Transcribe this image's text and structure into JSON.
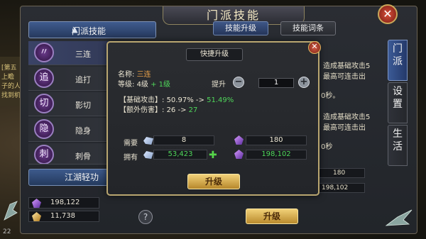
{
  "window": {
    "title": "门派技能"
  },
  "world": {
    "left_notes": [
      "[第五",
      "上瞻",
      "子的人",
      "找到机"
    ],
    "bottom_text": "22"
  },
  "left_panel": {
    "header": "门派技能",
    "skills": [
      {
        "glyph": "",
        "name": "三连"
      },
      {
        "glyph": "追",
        "name": "追打"
      },
      {
        "glyph": "切",
        "name": "影切"
      },
      {
        "glyph": "隐",
        "name": "隐身"
      },
      {
        "glyph": "刺",
        "name": "刺骨"
      }
    ],
    "kungfu_label": "江湖轻功",
    "resources": [
      {
        "value": "198,122"
      },
      {
        "value": "11,738"
      }
    ],
    "help": "?"
  },
  "tabs": {
    "upgrade": "技能升级",
    "affix": "技能词条"
  },
  "side_tabs": [
    {
      "label": "门派"
    },
    {
      "label": "设置"
    },
    {
      "label": "生活"
    }
  ],
  "behind": {
    "line1": "造成基础攻击5",
    "line2": "最高可连击出",
    "line3": "0秒。",
    "line4": "造成基础攻击5",
    "line5": "最高可连击出",
    "line6": "0秒",
    "box1": "180",
    "box2": "198,102",
    "upgrade_btn": "升级"
  },
  "popup": {
    "title": "快捷升级",
    "name_label": "名称:",
    "name_value": "三连",
    "level_label": "等级:",
    "level_value": "4级",
    "level_plus": "+ 1级",
    "raise_label": "提升",
    "quantity": "1",
    "stat1_label": "【基础攻击】:",
    "stat1_from": "50.97%",
    "stat1_arrow": "->",
    "stat1_to": "51.49%",
    "stat2_label": "【额外伤害】:",
    "stat2_from": "26",
    "stat2_arrow": "->",
    "stat2_to": "27",
    "need_label": "需要",
    "have_label": "拥有",
    "need_silver": "8",
    "need_gem": "180",
    "have_silver": "53,423",
    "have_gem": "198,102",
    "upgrade_btn": "升级"
  },
  "colors": {
    "accent_blue": "#3f5b8e",
    "gold": "#f2d27a",
    "green": "#4fd65a",
    "orange": "#e8a14a"
  }
}
